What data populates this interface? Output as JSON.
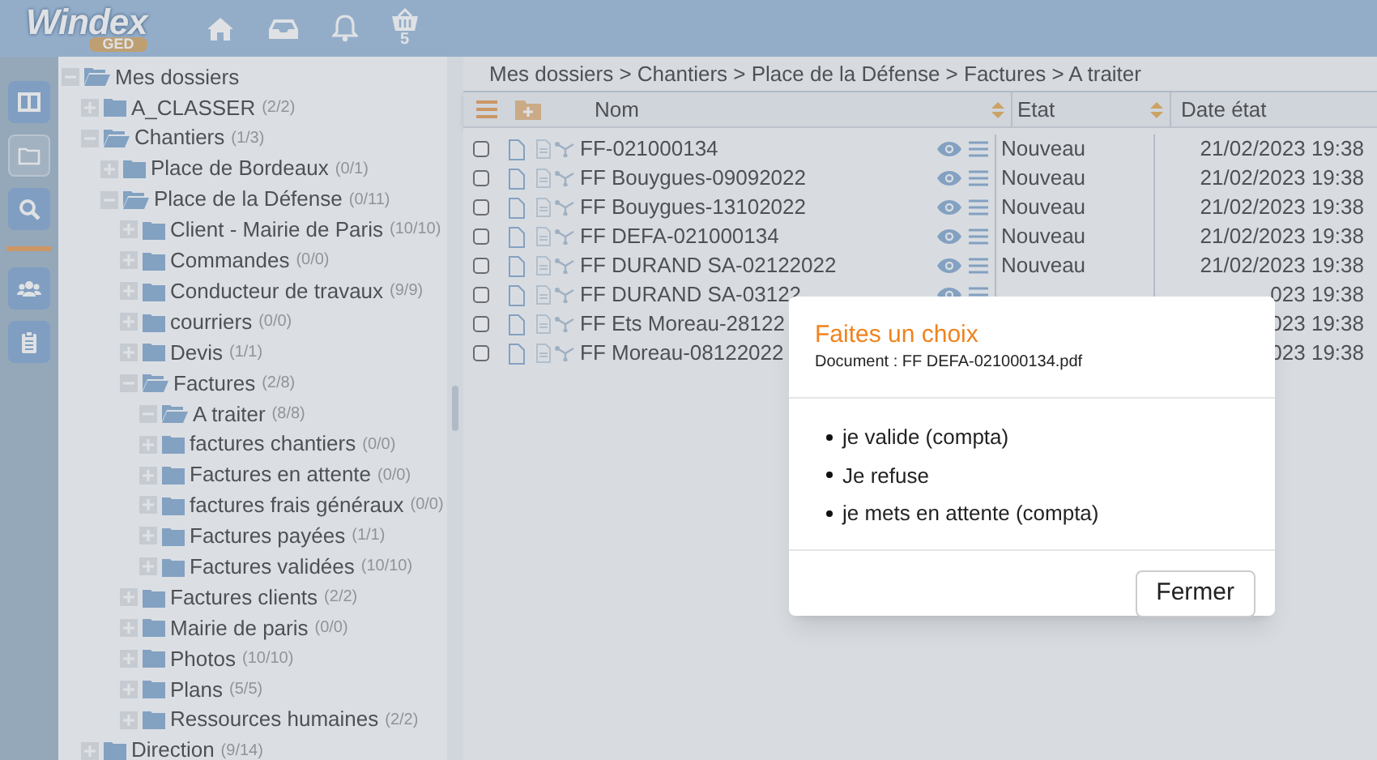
{
  "header": {
    "logo": "Windex",
    "logo_sub": "GED",
    "basket_count": "5"
  },
  "side_buttons": [
    {
      "kind": "columns"
    },
    {
      "kind": "folder"
    },
    {
      "kind": "search"
    },
    {
      "kind": "divider"
    },
    {
      "kind": "users"
    },
    {
      "kind": "clipboard"
    }
  ],
  "tree": [
    {
      "label": "Mes dossiers",
      "expanded": true,
      "children": [
        {
          "label": "A_CLASSER",
          "count": "(2/2)",
          "expanded": false
        },
        {
          "label": "Chantiers",
          "count": "(1/3)",
          "expanded": true,
          "children": [
            {
              "label": "Place de Bordeaux",
              "count": "(0/1)",
              "expanded": false
            },
            {
              "label": "Place de la Défense",
              "count": "(0/11)",
              "expanded": true,
              "children": [
                {
                  "label": "Client - Mairie de Paris",
                  "count": "(10/10)",
                  "expanded": false
                },
                {
                  "label": "Commandes",
                  "count": "(0/0)",
                  "expanded": false
                },
                {
                  "label": "Conducteur de travaux",
                  "count": "(9/9)",
                  "expanded": false
                },
                {
                  "label": "courriers",
                  "count": "(0/0)",
                  "expanded": false
                },
                {
                  "label": "Devis",
                  "count": "(1/1)",
                  "expanded": false
                },
                {
                  "label": "Factures",
                  "count": "(2/8)",
                  "expanded": true,
                  "children": [
                    {
                      "label": "A traiter",
                      "count": "(8/8)",
                      "expanded": true
                    },
                    {
                      "label": "factures chantiers",
                      "count": "(0/0)",
                      "expanded": false
                    },
                    {
                      "label": "Factures en attente",
                      "count": "(0/0)",
                      "expanded": false
                    },
                    {
                      "label": "factures frais généraux",
                      "count": "(0/0)",
                      "expanded": false
                    },
                    {
                      "label": "Factures payées",
                      "count": "(1/1)",
                      "expanded": false
                    },
                    {
                      "label": "Factures validées",
                      "count": "(10/10)",
                      "expanded": false
                    }
                  ]
                },
                {
                  "label": "Factures clients",
                  "count": "(2/2)",
                  "expanded": false
                },
                {
                  "label": "Mairie de paris",
                  "count": "(0/0)",
                  "expanded": false
                },
                {
                  "label": "Photos",
                  "count": "(10/10)",
                  "expanded": false
                },
                {
                  "label": "Plans",
                  "count": "(5/5)",
                  "expanded": false
                },
                {
                  "label": "Ressources humaines",
                  "count": "(2/2)",
                  "expanded": false
                }
              ]
            }
          ]
        },
        {
          "label": "Direction",
          "count": "(9/14)",
          "expanded": false
        }
      ]
    }
  ],
  "breadcrumb": "Mes dossiers > Chantiers > Place de la Défense > Factures > A traiter",
  "table": {
    "columns": [
      "Nom",
      "Etat",
      "Date état"
    ],
    "rows": [
      {
        "name": "FF-021000134",
        "state": "Nouveau",
        "date": "21/02/2023 19:38",
        "checked": false
      },
      {
        "name": "FF Bouygues-09092022",
        "state": "Nouveau",
        "date": "21/02/2023 19:38",
        "checked": false
      },
      {
        "name": "FF Bouygues-13102022",
        "state": "Nouveau",
        "date": "21/02/2023 19:38",
        "checked": false
      },
      {
        "name": "FF DEFA-021000134",
        "state": "Nouveau",
        "date": "21/02/2023 19:38",
        "checked": false
      },
      {
        "name": "FF DURAND SA-02122022",
        "state": "Nouveau",
        "date": "21/02/2023 19:38",
        "checked": false
      },
      {
        "name": "FF DURAND SA-03122",
        "date": "023 19:38",
        "checked": false
      },
      {
        "name": "FF Ets Moreau-28122",
        "date": "023 19:38",
        "checked": false,
        "actions": false
      },
      {
        "name": "FF Moreau-08122022",
        "date": "023 19:38",
        "checked": false,
        "actions": false
      }
    ]
  },
  "dialog": {
    "title": "Faites un choix",
    "subtitle": "Document : FF DEFA-021000134.pdf",
    "choices": [
      "je valide (compta)",
      "Je refuse",
      "je mets en attente (compta)"
    ],
    "close_button": "Fermer"
  }
}
